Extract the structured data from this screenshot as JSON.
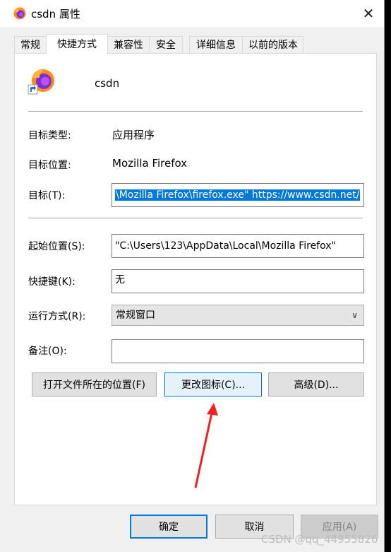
{
  "window": {
    "title": "csdn 属性",
    "close_glyph": "✕"
  },
  "tabs": [
    {
      "label": "常规",
      "active": false
    },
    {
      "label": "快捷方式",
      "active": true
    },
    {
      "label": "兼容性",
      "active": false
    },
    {
      "label": "安全",
      "active": false
    },
    {
      "label": "详细信息",
      "active": false
    },
    {
      "label": "以前的版本",
      "active": false
    }
  ],
  "header": {
    "name": "csdn"
  },
  "info": {
    "type_label": "目标类型:",
    "type_value": "应用程序",
    "location_label": "目标位置:",
    "location_value": "Mozilla Firefox",
    "target_label": "目标(T):",
    "target_value": "\\Mozilla Firefox\\firefox.exe\" https://www.csdn.net/"
  },
  "fields": {
    "start_label": "起始位置(S):",
    "start_value": "\"C:\\Users\\123\\AppData\\Local\\Mozilla Firefox\"",
    "hotkey_label": "快捷键(K):",
    "hotkey_value": "无",
    "run_label": "运行方式(R):",
    "run_value": "常规窗口",
    "comment_label": "备注(O):",
    "comment_value": ""
  },
  "buttons": {
    "open_location": "打开文件所在的位置(F)",
    "change_icon": "更改图标(C)...",
    "advanced": "高级(D)..."
  },
  "footer": {
    "ok": "确定",
    "cancel": "取消",
    "apply": "应用(A)"
  },
  "watermark": "CSDN @qq_44955826",
  "colors": {
    "accent": "#0078d7",
    "annotation_arrow": "#ee2222"
  }
}
